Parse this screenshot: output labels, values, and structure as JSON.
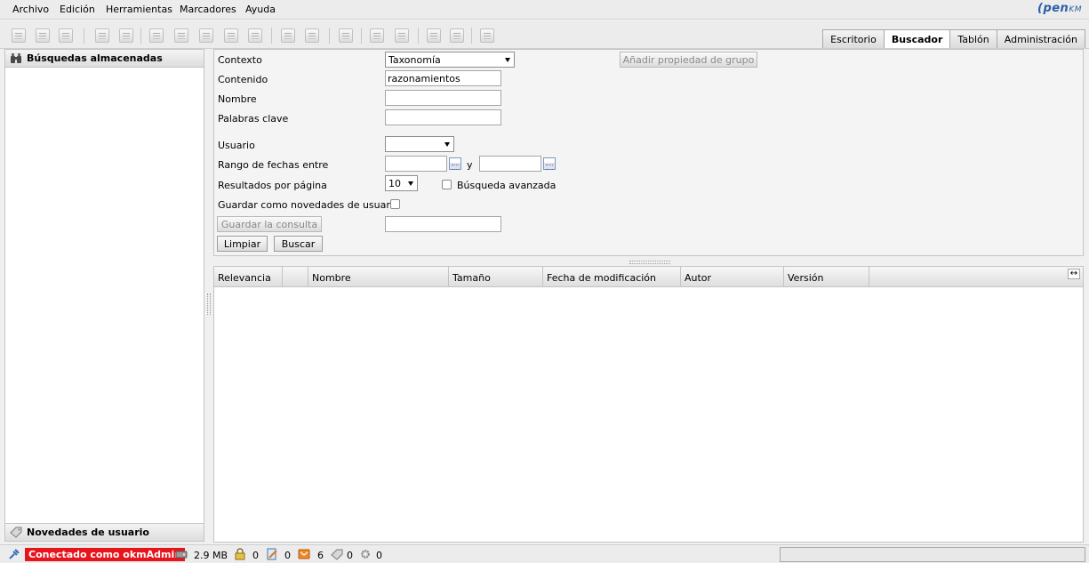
{
  "menu": {
    "items": [
      "Archivo",
      "Edición",
      "Herramientas",
      "Marcadores",
      "Ayuda"
    ],
    "logo_main": "pen",
    "logo_suffix": "KM"
  },
  "tabs": [
    "Escritorio",
    "Buscador",
    "Tablón",
    "Administración"
  ],
  "active_tab": "Buscador",
  "left_panel": {
    "top_title": "Búsquedas almacenadas",
    "bottom_title": "Novedades de usuario"
  },
  "form": {
    "contexto_label": "Contexto",
    "contexto_value": "Taxonomía",
    "contenido_label": "Contenido",
    "contenido_value": "razonamientos",
    "nombre_label": "Nombre",
    "nombre_value": "",
    "palabras_label": "Palabras clave",
    "palabras_value": "",
    "usuario_label": "Usuario",
    "usuario_value": "",
    "rango_label": "Rango de fechas entre",
    "rango_y": "y",
    "resultados_label": "Resultados por página",
    "resultados_value": "10",
    "avanzada_label": "Búsqueda avanzada",
    "guardar_novedades_label": "Guardar como novedades de usuario",
    "guardar_consulta_button": "Guardar la consulta",
    "limpiar_button": "Limpiar",
    "buscar_button": "Buscar",
    "add_group_button": "Añadir propiedad de grupo"
  },
  "results": {
    "columns": [
      "Relevancia",
      "",
      "Nombre",
      "Tamaño",
      "Fecha de modificación",
      "Autor",
      "Versión"
    ]
  },
  "status": {
    "connected": "Conectado como okmAdmin",
    "size": "2.9 MB",
    "locked": "0",
    "checkout": "0",
    "mail": "6",
    "subscribed": "0",
    "workflow": "0"
  },
  "colors": {
    "connected_bg": "#e8141c",
    "logo": "#2a5fa8"
  }
}
